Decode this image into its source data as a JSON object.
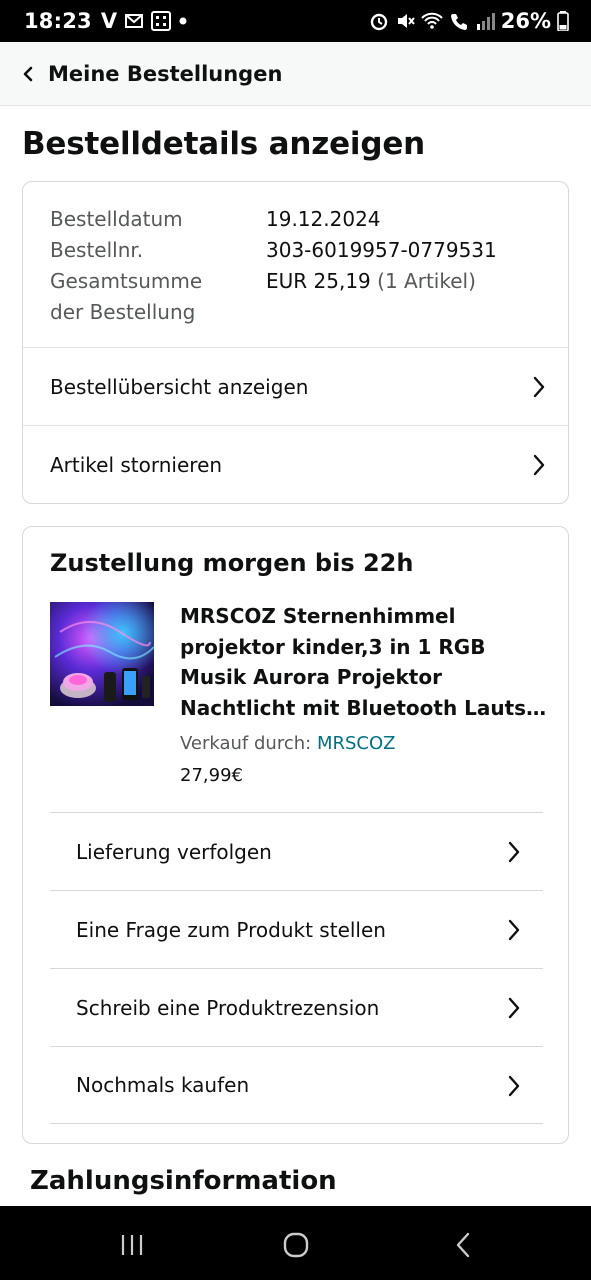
{
  "status_bar": {
    "time": "18:23",
    "carrier_v": "V",
    "battery": "26%"
  },
  "header": {
    "back_label": "Meine Bestellungen"
  },
  "page": {
    "title": "Bestelldetails anzeigen"
  },
  "order_summary": {
    "rows": [
      {
        "label": "Bestelldatum",
        "value": "19.12.2024"
      },
      {
        "label": "Bestellnr.",
        "value": "303-6019957-0779531"
      },
      {
        "label": "Gesamtsumme",
        "value": "EUR 25,19",
        "value_extra": "(1 Artikel)"
      },
      {
        "label": "der Bestellung",
        "value": ""
      }
    ],
    "actions": [
      {
        "label": "Bestellübersicht anzeigen"
      },
      {
        "label": "Artikel stornieren"
      }
    ]
  },
  "shipment": {
    "title": "Zustellung morgen bis 22h",
    "product": {
      "title": "MRSCOZ Sternenhimmel projektor kinder,3 in 1 RGB Musik Aurora Projektor Nachtlicht mit Bluetooth Lauts…",
      "seller_prefix": "Verkauf durch: ",
      "seller_name": "MRSCOZ",
      "price": "27,99€"
    },
    "actions": [
      {
        "label": "Lieferung verfolgen"
      },
      {
        "label": "Eine Frage zum Produkt stellen"
      },
      {
        "label": "Schreib eine Produktrezension"
      },
      {
        "label": "Nochmals kaufen"
      }
    ]
  },
  "payment": {
    "title": "Zahlungsinformation"
  },
  "colors": {
    "link": "#007185",
    "text": "#0f1111",
    "muted": "#565959",
    "border": "#d5d9d9"
  },
  "icons": [
    "alarm-icon",
    "mute-icon",
    "wifi-call-icon",
    "signal-icon",
    "battery-icon",
    "chevron-right-icon",
    "back-chevron-icon",
    "recents-icon",
    "home-icon",
    "back-nav-icon"
  ]
}
